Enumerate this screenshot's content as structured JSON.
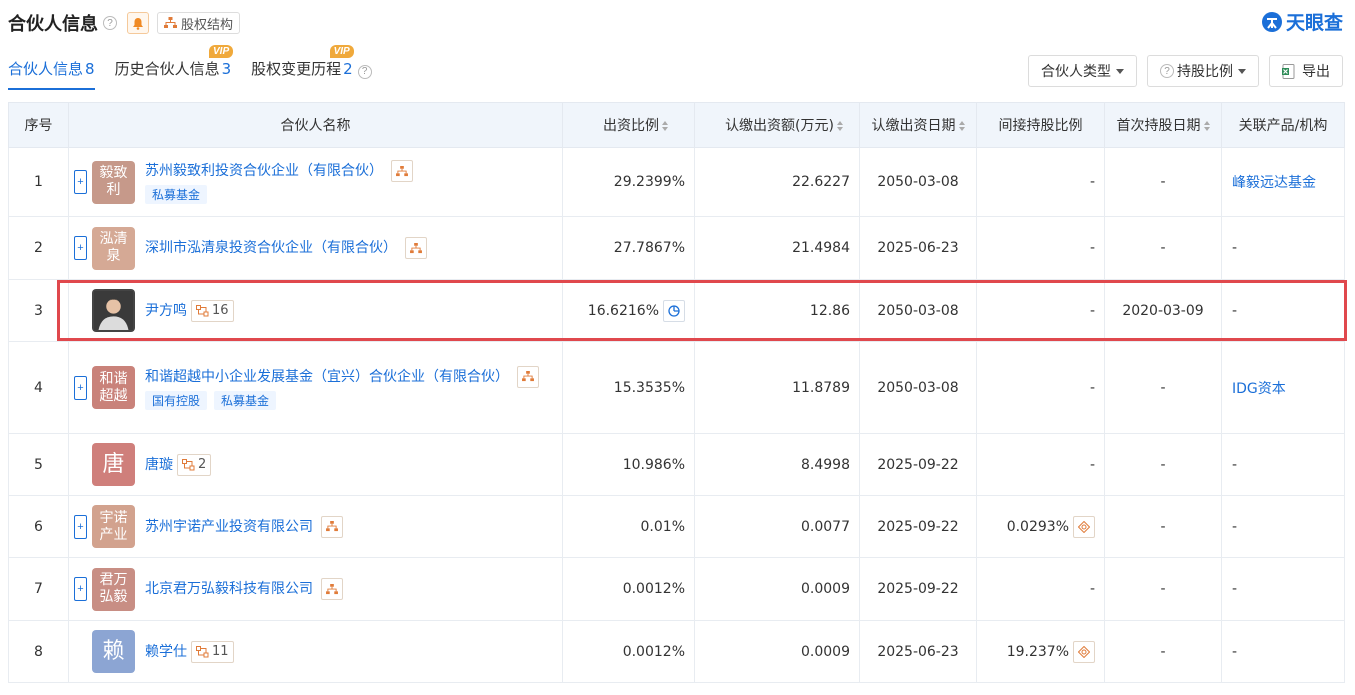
{
  "header": {
    "title": "合伙人信息",
    "help_icon": "?",
    "equity_label": "股权结构",
    "logo_text": "天眼查"
  },
  "tabs": [
    {
      "label": "合伙人信息",
      "count": "8",
      "active": true
    },
    {
      "label": "历史合伙人信息",
      "count": "3",
      "vip": "VIP"
    },
    {
      "label": "股权变更历程",
      "count": "2",
      "vip": "VIP",
      "help": "?"
    }
  ],
  "actions": {
    "partner_type": "合伙人类型",
    "holding_ratio": "持股比例",
    "export": "导出"
  },
  "columns": {
    "idx": "序号",
    "name": "合伙人名称",
    "ratio": "出资比例",
    "amount": "认缴出资额(万元)",
    "date": "认缴出资日期",
    "indirect": "间接持股比例",
    "first_date": "首次持股日期",
    "related": "关联产品/机构"
  },
  "rows": [
    {
      "idx": "1",
      "avatar": "毅致利",
      "avatar_color": "#c6998a",
      "name": "苏州毅致利投资合伙企业（有限合伙）",
      "tags": [
        "私募基金"
      ],
      "ratio": "29.2399%",
      "amount": "22.6227",
      "date": "2050-03-08",
      "indirect": "-",
      "first_date": "-",
      "related": "峰毅远达基金"
    },
    {
      "idx": "2",
      "avatar": "泓清泉",
      "avatar_color": "#d5a995",
      "name": "深圳市泓清泉投资合伙企业（有限合伙）",
      "tags": [],
      "ratio": "27.7867%",
      "amount": "21.4984",
      "date": "2025-06-23",
      "indirect": "-",
      "first_date": "-",
      "related": "-"
    },
    {
      "idx": "3",
      "avatar": "",
      "name": "尹方鸣",
      "rel_count": "16",
      "ratio": "16.6216%",
      "amount": "12.86",
      "date": "2050-03-08",
      "indirect": "-",
      "first_date": "2020-03-09",
      "related": "-"
    },
    {
      "idx": "4",
      "avatar": "和谐超越",
      "avatar_color": "#c9827a",
      "name": "和谐超越中小企业发展基金（宜兴）合伙企业（有限合伙）",
      "tags": [
        "国有控股",
        "私募基金"
      ],
      "ratio": "15.3535%",
      "amount": "11.8789",
      "date": "2050-03-08",
      "indirect": "-",
      "first_date": "-",
      "related": "IDG资本"
    },
    {
      "idx": "5",
      "avatar": "唐",
      "avatar_color": "#cf7f7b",
      "name": "唐璇",
      "rel_count": "2",
      "ratio": "10.986%",
      "amount": "8.4998",
      "date": "2025-09-22",
      "indirect": "-",
      "first_date": "-",
      "related": "-"
    },
    {
      "idx": "6",
      "avatar": "宇诺产业",
      "avatar_color": "#d2a28e",
      "name": "苏州宇诺产业投资有限公司",
      "tags": [],
      "ratio": "0.01%",
      "amount": "0.0077",
      "date": "2025-09-22",
      "indirect": "0.0293%",
      "first_date": "-",
      "related": "-"
    },
    {
      "idx": "7",
      "avatar": "君万弘毅",
      "avatar_color": "#c88e84",
      "name": "北京君万弘毅科技有限公司",
      "tags": [],
      "ratio": "0.0012%",
      "amount": "0.0009",
      "date": "2025-09-22",
      "indirect": "-",
      "first_date": "-",
      "related": "-"
    },
    {
      "idx": "8",
      "avatar": "赖",
      "avatar_color": "#8ca5d3",
      "name": "赖学仕",
      "rel_count": "11",
      "ratio": "0.0012%",
      "amount": "0.0009",
      "date": "2025-06-23",
      "indirect": "19.237%",
      "first_date": "-",
      "related": "-"
    }
  ]
}
